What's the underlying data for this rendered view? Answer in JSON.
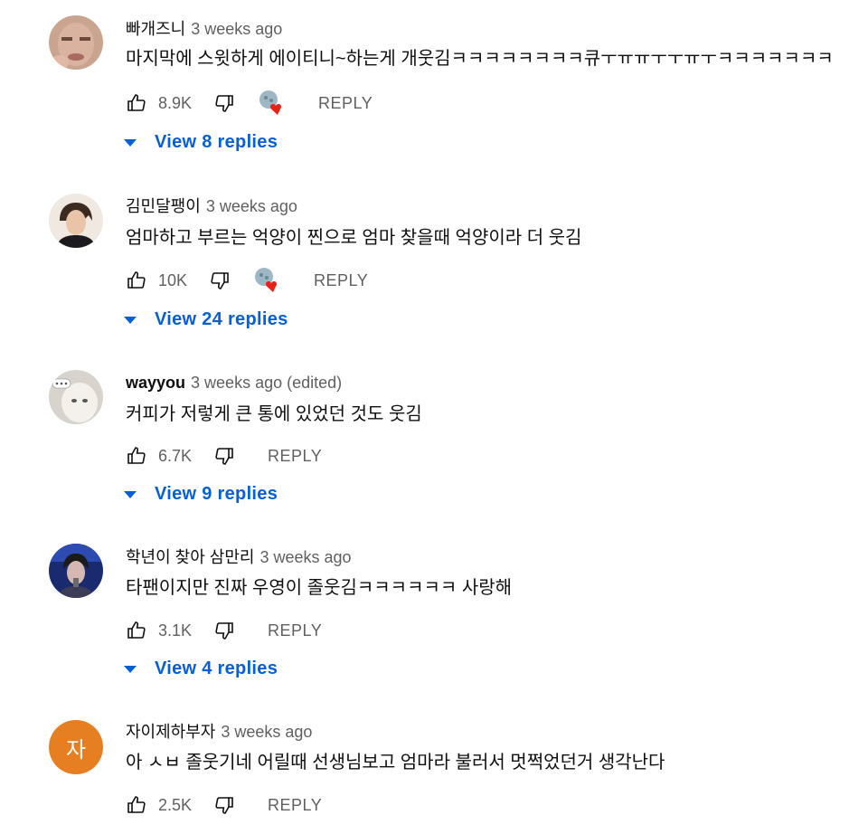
{
  "comments": [
    {
      "author": "빠개즈니",
      "time": "3 weeks ago",
      "text": "마지막에 스윗하게 에이티니~하는게 개웃김ㅋㅋㅋㅋㅋㅋㅋㅋ큐ㅜㅠㅠㅜㅜㅠㅜㅋㅋㅋㅋㅋㅋㅋ",
      "likes": "8.9K",
      "reply_label": "REPLY",
      "replies_label": "View 8 replies",
      "creator_heart": true,
      "avatar": "photo-face"
    },
    {
      "author": "김민달팽이",
      "time": "3 weeks ago",
      "text": "엄마하고 부르는 억양이 찐으로 엄마 찾을때 억양이라 더 웃김",
      "likes": "10K",
      "reply_label": "REPLY",
      "replies_label": "View 24 replies",
      "creator_heart": true,
      "avatar": "photo-man"
    },
    {
      "author": "wayyou",
      "time": "3 weeks ago (edited)",
      "text": "커피가 저렇게 큰 통에 있었던 것도 웃김",
      "likes": "6.7K",
      "reply_label": "REPLY",
      "replies_label": "View 9 replies",
      "creator_heart": false,
      "avatar": "photo-cat"
    },
    {
      "author": "학년이 찾아 삼만리",
      "time": "3 weeks ago",
      "text": "타팬이지만 진짜 우영이 졸웃김ㅋㅋㅋㅋㅋㅋ 사랑해",
      "likes": "3.1K",
      "reply_label": "REPLY",
      "replies_label": "View 4 replies",
      "creator_heart": false,
      "avatar": "photo-stage"
    },
    {
      "author": "자이제하부자",
      "time": "3 weeks ago",
      "text": "아 ㅅㅂ 졸웃기네 어릴때 선생님보고 엄마라 불러서 멋쩍었던거 생각난다",
      "likes": "2.5K",
      "reply_label": "REPLY",
      "avatar_letter": "자",
      "creator_heart": false,
      "avatar": "letter"
    }
  ],
  "colors": {
    "link_blue": "#065fd4",
    "secondary_text": "#606060",
    "heart_red": "#e62117",
    "letter_avatar_bg": "#e67e22"
  }
}
